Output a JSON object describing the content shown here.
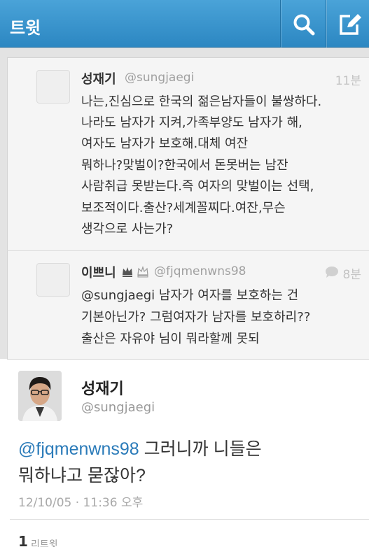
{
  "header": {
    "title": "트윗",
    "color_top": "#4aa3d8",
    "color_bottom": "#2c87c2",
    "buttons": [
      "search-icon",
      "compose-icon"
    ]
  },
  "conversation": [
    {
      "name": "성재기",
      "handle": "@sungjaegi",
      "time": "11분",
      "lines": [
        "나는,진심으로 한국의 젊은남자들이 불쌍하다.",
        "나라도 남자가 지켜,가족부양도 남자가 해,",
        "여자도 남자가 보호해.대체 여잔",
        "뭐하나?맞벌이?한국에서 돈못버는 남잔",
        "사람취급 못받는다.즉 여자의 맞벌이는 선택,",
        "보조적이다.출산?세계꼴찌다.여잔,무슨",
        "생각으로 사는가?"
      ]
    },
    {
      "name": "이쁘니",
      "handle": "@fjqmenwns98",
      "time": "8분",
      "lines": [
        "@sungjaegi 남자가 여자를 보호하는 건",
        "기본아닌가? 그럼여자가 남자를 보호하리??",
        "출산은 자유야 님이 뭐라할께 못되"
      ]
    }
  ],
  "main_tweet": {
    "name": "성재기",
    "handle": "@sungjaegi",
    "mention": "@fjqmenwns98",
    "line1_rest": " 그러니까 니들은",
    "line2": "뭐하냐고 묻잖아?",
    "date": "12/10/05 · 11:36 오후",
    "retweet_count": "1",
    "retweet_label": "리트윗"
  },
  "colors": {
    "link": "#2b7bb9",
    "muted": "#a0a0a0"
  }
}
